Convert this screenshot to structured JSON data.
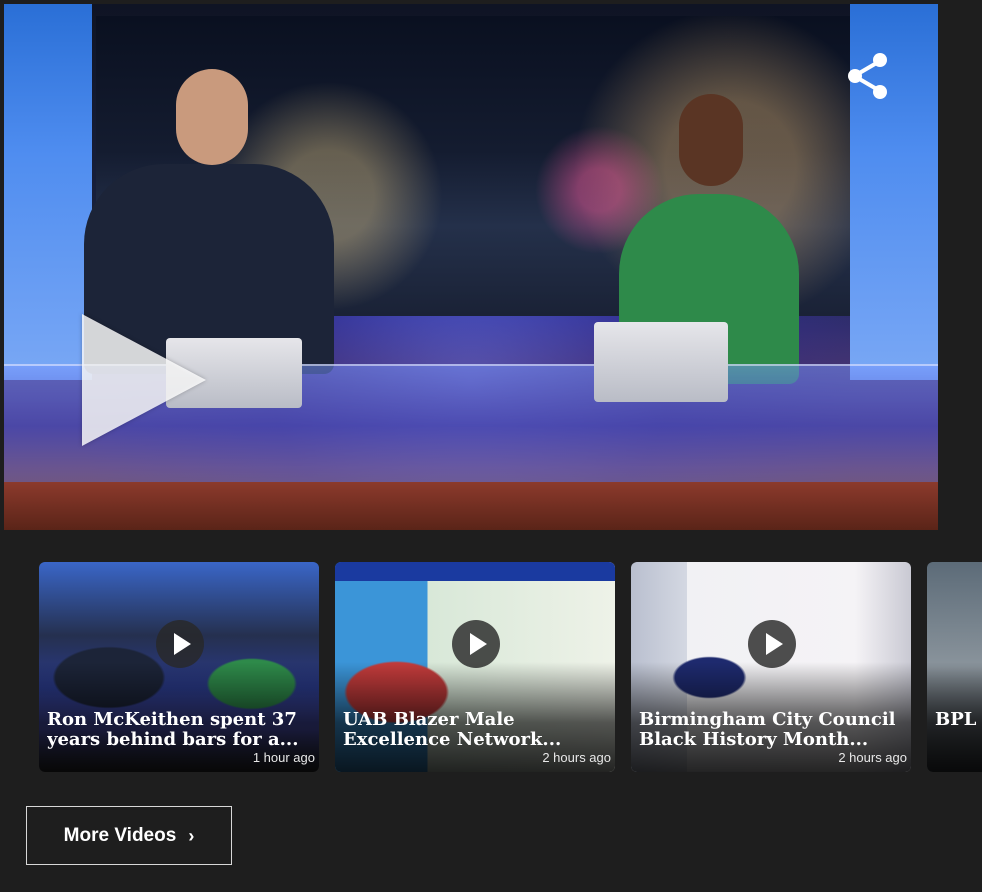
{
  "player": {
    "share_icon": "share-icon",
    "play_icon": "play-icon"
  },
  "videos": [
    {
      "title": "Ron McKeithen spent 37 years behind bars for a...",
      "time": "1 hour ago"
    },
    {
      "title": "UAB Blazer Male Excellence Network...",
      "time": "2 hours ago"
    },
    {
      "title": "Birmingham City Council Black History Month...",
      "time": "2 hours ago"
    },
    {
      "title": "BPL Hist",
      "time": ""
    }
  ],
  "more_videos": {
    "label": "More Videos",
    "icon": "chevron-right-icon"
  },
  "colors": {
    "background": "#1e1e1e",
    "text": "#ffffff"
  }
}
